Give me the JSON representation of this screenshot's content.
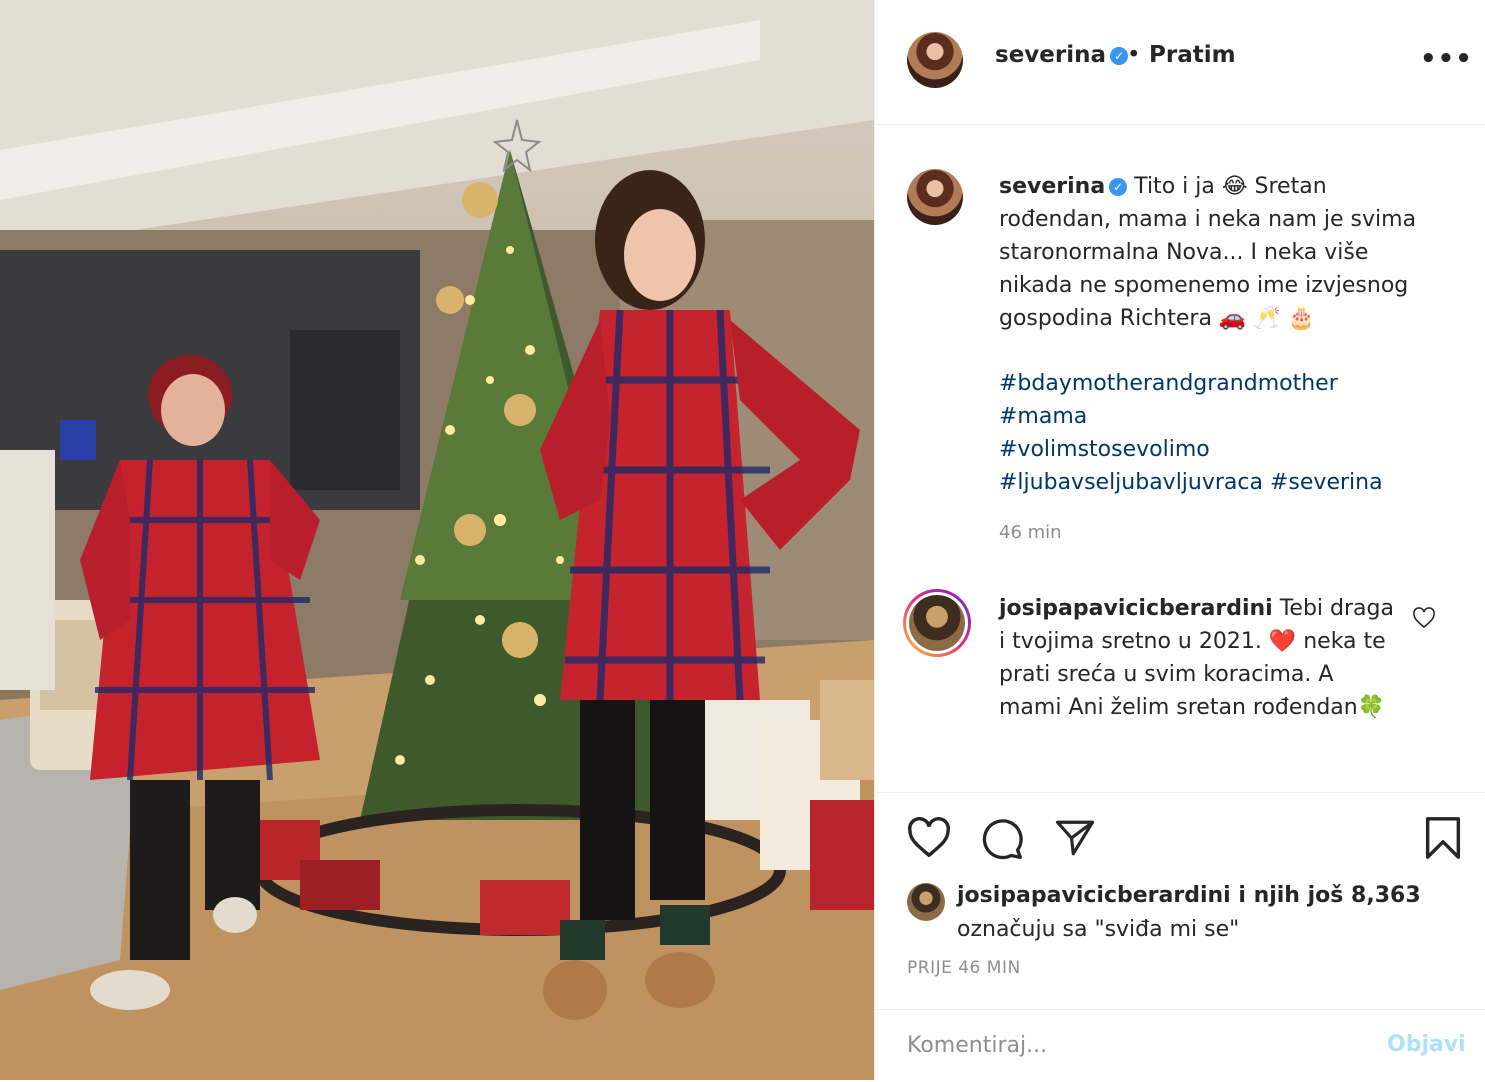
{
  "post": {
    "username": "severina",
    "follow_label": "Pratim",
    "follow_dot": "•",
    "more_label": "•••",
    "verified_glyph": "✓"
  },
  "caption": {
    "username": "severina",
    "text": "Tito i ja 😂 Sretan rođendan, mama i neka nam je svima staronormalna Nova... I neka više nikada ne spomenemo ime izvjesnog gospodina Richtera 🚗 🥂 🎂",
    "hashtags_line1": "#bdaymotherandgrandmother",
    "hashtags_line2": "#mama",
    "hashtags_line3": "#volimstosevolimo",
    "hashtags_line4a": "#ljubavseljubavljuvraca",
    "hashtags_line4b": "#severina",
    "time": "46 min"
  },
  "comment": {
    "username": "josipapavicicberardini",
    "text": "Tebi draga i tvojima sretno u 2021. ❤️ neka te prati sreća u svim koracima. A mami Ani želim sretan rođendan🍀"
  },
  "likes": {
    "username": "josipapavicicberardini",
    "rest": " i njih još 8,363",
    "line2": "označuju sa \"sviđa mi se\""
  },
  "post_time": "PRIJE 46 MIN",
  "comment_box": {
    "placeholder": "Komentiraj...",
    "post_label": "Objavi"
  },
  "colors": {
    "link": "#00376b",
    "post_btn_disabled": "#b2dffc",
    "verified": "#3897f0",
    "secondary_text": "#8e8e8e"
  },
  "icons": [
    "heart-icon",
    "comment-icon",
    "share-icon",
    "bookmark-icon",
    "more-icon",
    "verified-icon"
  ]
}
